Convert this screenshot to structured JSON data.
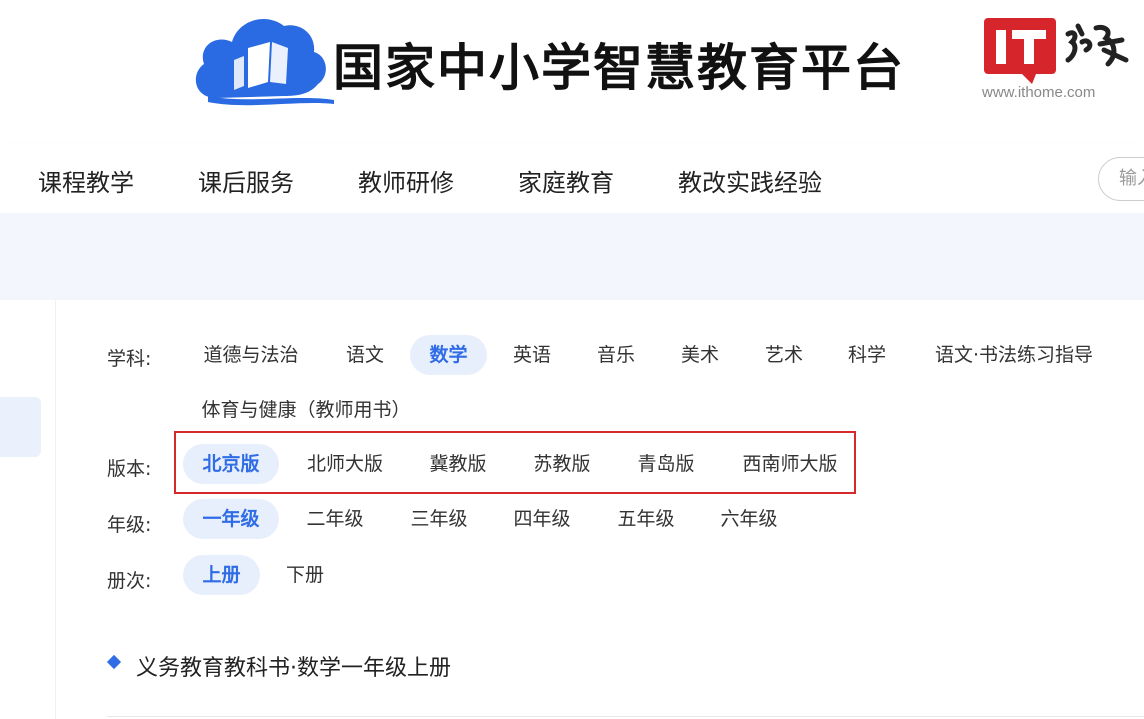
{
  "header": {
    "site_title": "国家中小学智慧教育平台",
    "watermark_url": "www.ithome.com"
  },
  "nav": {
    "items": [
      "课程教学",
      "课后服务",
      "教师研修",
      "家庭教育",
      "教改实践经验"
    ],
    "search_placeholder": "输入"
  },
  "filters": {
    "subject": {
      "label": "学科:",
      "options": [
        "道德与法治",
        "语文",
        "数学",
        "英语",
        "音乐",
        "美术",
        "艺术",
        "科学",
        "语文·书法练习指导",
        "体育与健康（教师用书）"
      ],
      "selected": "数学"
    },
    "edition": {
      "label": "版本:",
      "options": [
        "北京版",
        "北师大版",
        "冀教版",
        "苏教版",
        "青岛版",
        "西南师大版"
      ],
      "selected": "北京版"
    },
    "grade": {
      "label": "年级:",
      "options": [
        "一年级",
        "二年级",
        "三年级",
        "四年级",
        "五年级",
        "六年级"
      ],
      "selected": "一年级"
    },
    "volume": {
      "label": "册次:",
      "options": [
        "上册",
        "下册"
      ],
      "selected": "上册"
    }
  },
  "result": {
    "title": "义务教育教科书·数学一年级上册"
  },
  "colors": {
    "accent": "#2f6ce5",
    "chip_active_bg": "#e8effc",
    "highlight_border": "#d6282d",
    "logo_blue": "#2a6ae3",
    "ithome_red": "#d7262b"
  }
}
